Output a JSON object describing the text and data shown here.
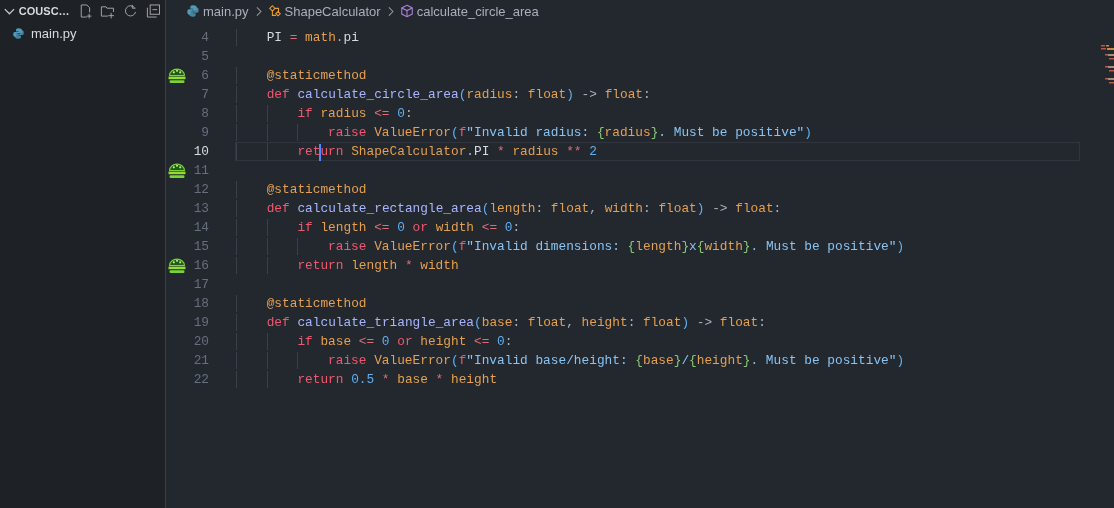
{
  "explorer": {
    "folder": "COUSC…",
    "expanded": true,
    "files": [
      {
        "name": "main.py",
        "selected": false
      }
    ]
  },
  "breadcrumb": [
    {
      "kind": "file",
      "label": "main.py"
    },
    {
      "kind": "class",
      "label": "ShapeCalculator"
    },
    {
      "kind": "method",
      "label": "calculate_circle_area"
    }
  ],
  "editor": {
    "lines": [
      {
        "number": "4",
        "current": false,
        "marker": false,
        "tokens": [
          {
            "kind": "plain",
            "text": "PI"
          },
          {
            "kind": "op",
            "text": " = "
          },
          {
            "kind": "cls",
            "text": "math"
          },
          {
            "kind": "pun",
            "text": "."
          },
          {
            "kind": "plain",
            "text": "pi"
          }
        ]
      },
      {
        "number": "5",
        "current": false,
        "marker": false
      },
      {
        "number": "6",
        "current": false,
        "marker": true,
        "tokens": [
          {
            "kind": "dec",
            "text": "@staticmethod"
          }
        ]
      },
      {
        "number": "7",
        "current": false,
        "marker": false,
        "tokens": [
          {
            "kind": "kw",
            "text": "def"
          },
          {
            "kind": "fn",
            "text": " calculate_circle_area"
          },
          {
            "kind": "paren",
            "text": "("
          },
          {
            "kind": "p",
            "text": "radius"
          },
          {
            "kind": "pun",
            "text": ": "
          },
          {
            "kind": "ty",
            "text": "float"
          },
          {
            "kind": "paren",
            "text": ")"
          },
          {
            "kind": "pun",
            "text": " -> "
          },
          {
            "kind": "ty",
            "text": "float"
          },
          {
            "kind": "pun",
            "text": ":"
          }
        ],
        "children": [
          {
            "number": "8",
            "current": false,
            "marker": false,
            "tokens": [
              {
                "kind": "kw",
                "text": "if"
              },
              {
                "kind": "p",
                "text": " radius"
              },
              {
                "kind": "op",
                "text": " <= "
              },
              {
                "kind": "num",
                "text": "0"
              },
              {
                "kind": "pun",
                "text": ":"
              }
            ],
            "children": [
              {
                "number": "9",
                "current": false,
                "marker": false,
                "tokens": [
                  {
                    "kind": "kw",
                    "text": "raise"
                  },
                  {
                    "kind": "call",
                    "text": " ValueError"
                  },
                  {
                    "kind": "paren",
                    "text": "("
                  },
                  {
                    "kind": "kw",
                    "text": "f"
                  },
                  {
                    "kind": "str",
                    "text": "\"Invalid radius: "
                  },
                  {
                    "kind": "brace",
                    "text": "{"
                  },
                  {
                    "kind": "p",
                    "text": "radius"
                  },
                  {
                    "kind": "brace",
                    "text": "}"
                  },
                  {
                    "kind": "str",
                    "text": ". Must be positive\""
                  },
                  {
                    "kind": "paren",
                    "text": ")"
                  }
                ]
              }
            ]
          },
          {
            "number": "10",
            "current": true,
            "marker": false,
            "tokens": [
              {
                "kind": "kw",
                "text": "ret",
                "caret_after": true
              },
              {
                "kind": "kw",
                "text": "urn"
              },
              {
                "kind": "cls",
                "text": " ShapeCalculator"
              },
              {
                "kind": "pun",
                "text": "."
              },
              {
                "kind": "plain",
                "text": "PI"
              },
              {
                "kind": "op",
                "text": " * "
              },
              {
                "kind": "p",
                "text": "radius"
              },
              {
                "kind": "op",
                "text": " ** "
              },
              {
                "kind": "num",
                "text": "2"
              }
            ]
          }
        ]
      },
      {
        "number": "11",
        "current": false,
        "marker": true
      },
      {
        "number": "12",
        "current": false,
        "marker": false,
        "tokens": [
          {
            "kind": "dec",
            "text": "@staticmethod"
          }
        ]
      },
      {
        "number": "13",
        "current": false,
        "marker": false,
        "tokens": [
          {
            "kind": "kw",
            "text": "def"
          },
          {
            "kind": "fn",
            "text": " calculate_rectangle_area"
          },
          {
            "kind": "paren",
            "text": "("
          },
          {
            "kind": "p",
            "text": "length"
          },
          {
            "kind": "pun",
            "text": ": "
          },
          {
            "kind": "ty",
            "text": "float"
          },
          {
            "kind": "pun",
            "text": ", "
          },
          {
            "kind": "p",
            "text": "width"
          },
          {
            "kind": "pun",
            "text": ": "
          },
          {
            "kind": "ty",
            "text": "float"
          },
          {
            "kind": "paren",
            "text": ")"
          },
          {
            "kind": "pun",
            "text": " -> "
          },
          {
            "kind": "ty",
            "text": "float"
          },
          {
            "kind": "pun",
            "text": ":"
          }
        ],
        "children": [
          {
            "number": "14",
            "current": false,
            "marker": false,
            "tokens": [
              {
                "kind": "kw",
                "text": "if"
              },
              {
                "kind": "p",
                "text": " length"
              },
              {
                "kind": "op",
                "text": " <= "
              },
              {
                "kind": "num",
                "text": "0"
              },
              {
                "kind": "kw",
                "text": " or"
              },
              {
                "kind": "p",
                "text": " width"
              },
              {
                "kind": "op",
                "text": " <= "
              },
              {
                "kind": "num",
                "text": "0"
              },
              {
                "kind": "pun",
                "text": ":"
              }
            ],
            "children": [
              {
                "number": "15",
                "current": false,
                "marker": false,
                "tokens": [
                  {
                    "kind": "kw",
                    "text": "raise"
                  },
                  {
                    "kind": "call",
                    "text": " ValueError"
                  },
                  {
                    "kind": "paren",
                    "text": "("
                  },
                  {
                    "kind": "kw",
                    "text": "f"
                  },
                  {
                    "kind": "str",
                    "text": "\"Invalid dimensions: "
                  },
                  {
                    "kind": "brace",
                    "text": "{"
                  },
                  {
                    "kind": "p",
                    "text": "length"
                  },
                  {
                    "kind": "brace",
                    "text": "}"
                  },
                  {
                    "kind": "str",
                    "text": "x"
                  },
                  {
                    "kind": "brace",
                    "text": "{"
                  },
                  {
                    "kind": "p",
                    "text": "width"
                  },
                  {
                    "kind": "brace",
                    "text": "}"
                  },
                  {
                    "kind": "str",
                    "text": ". Must be positive\""
                  },
                  {
                    "kind": "paren",
                    "text": ")"
                  }
                ]
              }
            ]
          },
          {
            "number": "16",
            "current": false,
            "marker": true,
            "tokens": [
              {
                "kind": "kw",
                "text": "return"
              },
              {
                "kind": "p",
                "text": " length"
              },
              {
                "kind": "op",
                "text": " * "
              },
              {
                "kind": "p",
                "text": "width"
              }
            ]
          }
        ]
      },
      {
        "number": "17",
        "current": false,
        "marker": false
      },
      {
        "number": "18",
        "current": false,
        "marker": false,
        "tokens": [
          {
            "kind": "dec",
            "text": "@staticmethod"
          }
        ]
      },
      {
        "number": "19",
        "current": false,
        "marker": false,
        "tokens": [
          {
            "kind": "kw",
            "text": "def"
          },
          {
            "kind": "fn",
            "text": " calculate_triangle_area"
          },
          {
            "kind": "paren",
            "text": "("
          },
          {
            "kind": "p",
            "text": "base"
          },
          {
            "kind": "pun",
            "text": ": "
          },
          {
            "kind": "ty",
            "text": "float"
          },
          {
            "kind": "pun",
            "text": ", "
          },
          {
            "kind": "p",
            "text": "height"
          },
          {
            "kind": "pun",
            "text": ": "
          },
          {
            "kind": "ty",
            "text": "float"
          },
          {
            "kind": "paren",
            "text": ")"
          },
          {
            "kind": "pun",
            "text": " -> "
          },
          {
            "kind": "ty",
            "text": "float"
          },
          {
            "kind": "pun",
            "text": ":"
          }
        ],
        "children": [
          {
            "number": "20",
            "current": false,
            "marker": false,
            "tokens": [
              {
                "kind": "kw",
                "text": "if"
              },
              {
                "kind": "p",
                "text": " base"
              },
              {
                "kind": "op",
                "text": " <= "
              },
              {
                "kind": "num",
                "text": "0"
              },
              {
                "kind": "kw",
                "text": " or"
              },
              {
                "kind": "p",
                "text": " height"
              },
              {
                "kind": "op",
                "text": " <= "
              },
              {
                "kind": "num",
                "text": "0"
              },
              {
                "kind": "pun",
                "text": ":"
              }
            ],
            "children": [
              {
                "number": "21",
                "current": false,
                "marker": false,
                "tokens": [
                  {
                    "kind": "kw",
                    "text": "raise"
                  },
                  {
                    "kind": "call",
                    "text": " ValueError"
                  },
                  {
                    "kind": "paren",
                    "text": "("
                  },
                  {
                    "kind": "kw",
                    "text": "f"
                  },
                  {
                    "kind": "str",
                    "text": "\"Invalid base/height: "
                  },
                  {
                    "kind": "brace",
                    "text": "{"
                  },
                  {
                    "kind": "p",
                    "text": "base"
                  },
                  {
                    "kind": "brace",
                    "text": "}"
                  },
                  {
                    "kind": "str",
                    "text": "/"
                  },
                  {
                    "kind": "brace",
                    "text": "{"
                  },
                  {
                    "kind": "p",
                    "text": "height"
                  },
                  {
                    "kind": "brace",
                    "text": "}"
                  },
                  {
                    "kind": "str",
                    "text": ". Must be positive\""
                  },
                  {
                    "kind": "paren",
                    "text": ")"
                  }
                ]
              }
            ]
          },
          {
            "number": "22",
            "current": false,
            "marker": false,
            "tokens": [
              {
                "kind": "kw",
                "text": "return"
              },
              {
                "kind": "num",
                "text": " 0.5"
              },
              {
                "kind": "op",
                "text": " * "
              },
              {
                "kind": "p",
                "text": "base"
              },
              {
                "kind": "op",
                "text": " * "
              },
              {
                "kind": "p",
                "text": "height"
              }
            ]
          }
        ]
      }
    ]
  }
}
